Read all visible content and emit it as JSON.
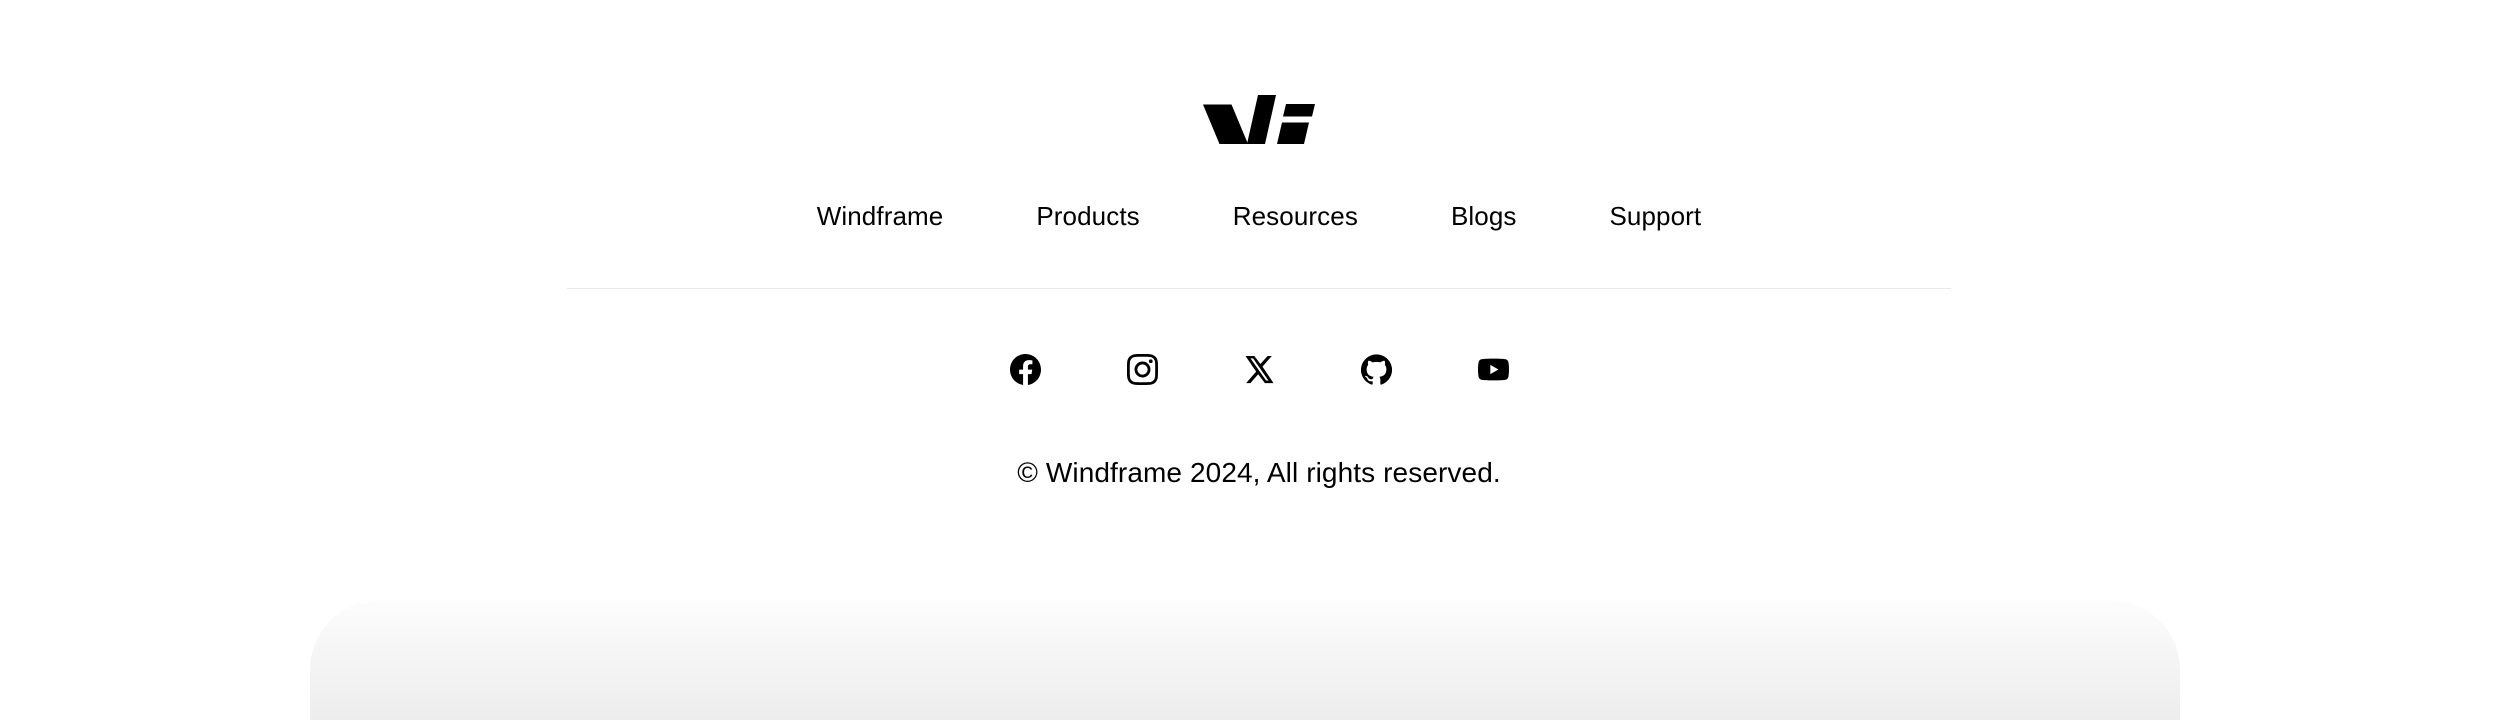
{
  "theme": {
    "background": "#ffffff",
    "foreground": "#000000",
    "divider": "#e9e9ea",
    "peek_panel": "#ededed"
  },
  "footer": {
    "logo": {
      "name": "windframe-logo",
      "alt": "Windframe"
    },
    "nav": {
      "items": [
        {
          "label": "Windframe",
          "name": "nav-link-windframe"
        },
        {
          "label": "Products",
          "name": "nav-link-products"
        },
        {
          "label": "Resources",
          "name": "nav-link-resources"
        },
        {
          "label": "Blogs",
          "name": "nav-link-blogs"
        },
        {
          "label": "Support",
          "name": "nav-link-support"
        }
      ]
    },
    "social": {
      "items": [
        {
          "label": "Facebook",
          "icon": "facebook-icon"
        },
        {
          "label": "Instagram",
          "icon": "instagram-icon"
        },
        {
          "label": "X",
          "icon": "x-twitter-icon"
        },
        {
          "label": "GitHub",
          "icon": "github-icon"
        },
        {
          "label": "YouTube",
          "icon": "youtube-icon"
        }
      ]
    },
    "copyright": "© Windframe 2024, All rights reserved."
  }
}
